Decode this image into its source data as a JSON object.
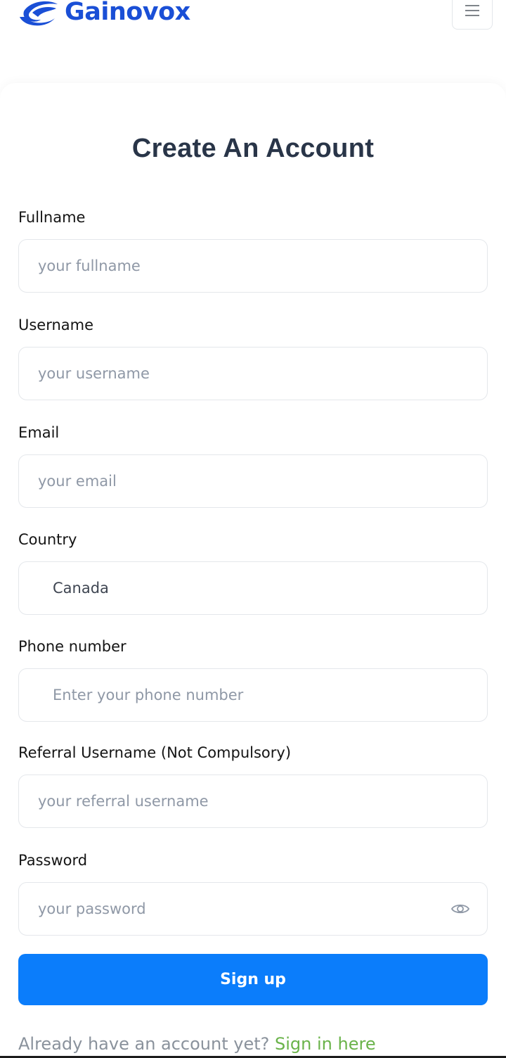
{
  "header": {
    "brand": "Gainovox",
    "logo_icon": "gainovox-logo-icon",
    "menu_icon": "hamburger-menu-icon"
  },
  "form": {
    "title": "Create An Account",
    "fields": {
      "fullname": {
        "label": "Fullname",
        "placeholder": "your fullname"
      },
      "username": {
        "label": "Username",
        "placeholder": "your username"
      },
      "email": {
        "label": "Email",
        "placeholder": "your email"
      },
      "country": {
        "label": "Country",
        "value": "Canada"
      },
      "phone": {
        "label": "Phone number",
        "placeholder": "Enter your phone number"
      },
      "referral": {
        "label": "Referral Username (Not Compulsory)",
        "placeholder": "your referral username"
      },
      "password": {
        "label": "Password",
        "placeholder": "your password",
        "toggle_icon": "eye-icon"
      }
    },
    "submit_label": "Sign up",
    "signin_prompt": "Already have an account yet?",
    "signin_link": "Sign in here"
  },
  "colors": {
    "brand": "#1a4fd6",
    "primary_button": "#0b7dfb",
    "link": "#6ab34a",
    "title": "#293548"
  }
}
